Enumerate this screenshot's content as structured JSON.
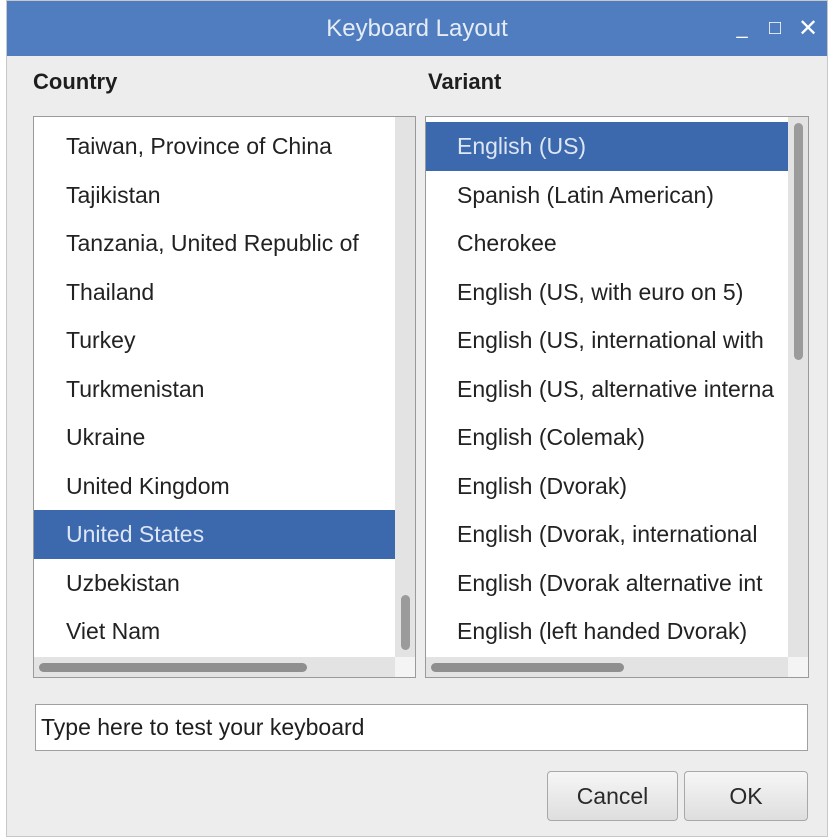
{
  "window": {
    "title": "Keyboard Layout",
    "minimize_glyph": "_",
    "maximize_glyph": "□",
    "close_glyph": "✕"
  },
  "country": {
    "heading": "Country",
    "items": [
      "Taiwan, Province of China",
      "Tajikistan",
      "Tanzania, United Republic of",
      "Thailand",
      "Turkey",
      "Turkmenistan",
      "Ukraine",
      "United Kingdom",
      "United States",
      "Uzbekistan",
      "Viet Nam"
    ],
    "selected": "United States"
  },
  "variant": {
    "heading": "Variant",
    "items": [
      "English (US)",
      "Spanish (Latin American)",
      "Cherokee",
      "English (US, with euro on 5)",
      "English (US, international with",
      "English (US, alternative interna",
      "English (Colemak)",
      "English (Dvorak)",
      "English (Dvorak, international",
      "English (Dvorak alternative int",
      "English (left handed Dvorak)"
    ],
    "selected": "English (US)"
  },
  "test_field": {
    "placeholder": "Type here to test your keyboard"
  },
  "buttons": {
    "cancel": "Cancel",
    "ok": "OK"
  },
  "colors": {
    "titlebar": "#4f7dbf",
    "selection": "#3c68ae"
  }
}
